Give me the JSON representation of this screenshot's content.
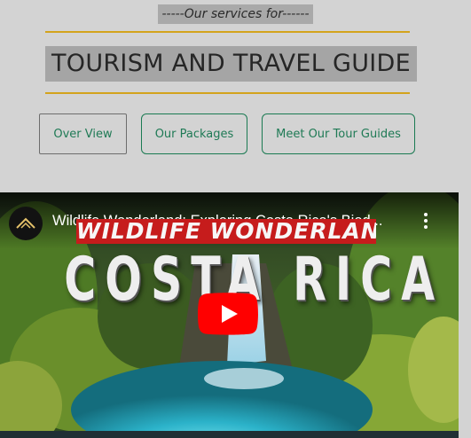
{
  "header": {
    "subtitle": "-----Our services for------",
    "title": "TOURISM AND TRAVEL GUIDE"
  },
  "nav": {
    "overview": "Over View",
    "packages": "Our Packages",
    "guides": "Meet Our Tour Guides"
  },
  "video": {
    "title": "Wildlife Wonderland: Exploring Costa Rica's Biod...",
    "banner_text": "WILDLIFE WONDERLAND",
    "headline": "COSTA RICA"
  },
  "colors": {
    "accent_rule": "#d3a31c",
    "button_text": "#1f7a55",
    "youtube_red": "#ff0000"
  }
}
